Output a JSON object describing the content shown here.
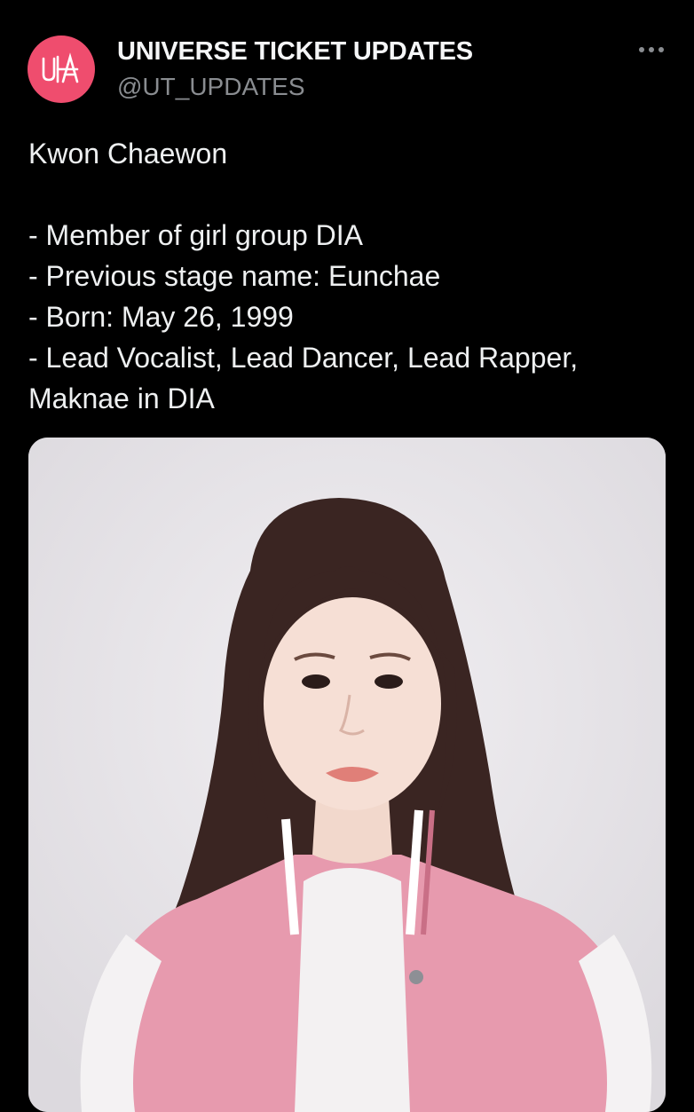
{
  "tweet": {
    "author": {
      "display_name": "UNIVERSE TICKET UPDATES",
      "handle": "@UT_UPDATES",
      "avatar_color": "#ef4d6e"
    },
    "more_icon": "more-horizontal-icon",
    "lines": [
      "Kwon Chaewon",
      "",
      "- Member of girl group DIA",
      "- Previous stage name: Eunchae",
      "- Born: May 26, 1999",
      "- Lead Vocalist, Lead Dancer, Lead Rapper,",
      "Maknae in DIA"
    ],
    "media": {
      "background_color": "#e9e7ea",
      "jacket_color": "#e79aae"
    }
  }
}
